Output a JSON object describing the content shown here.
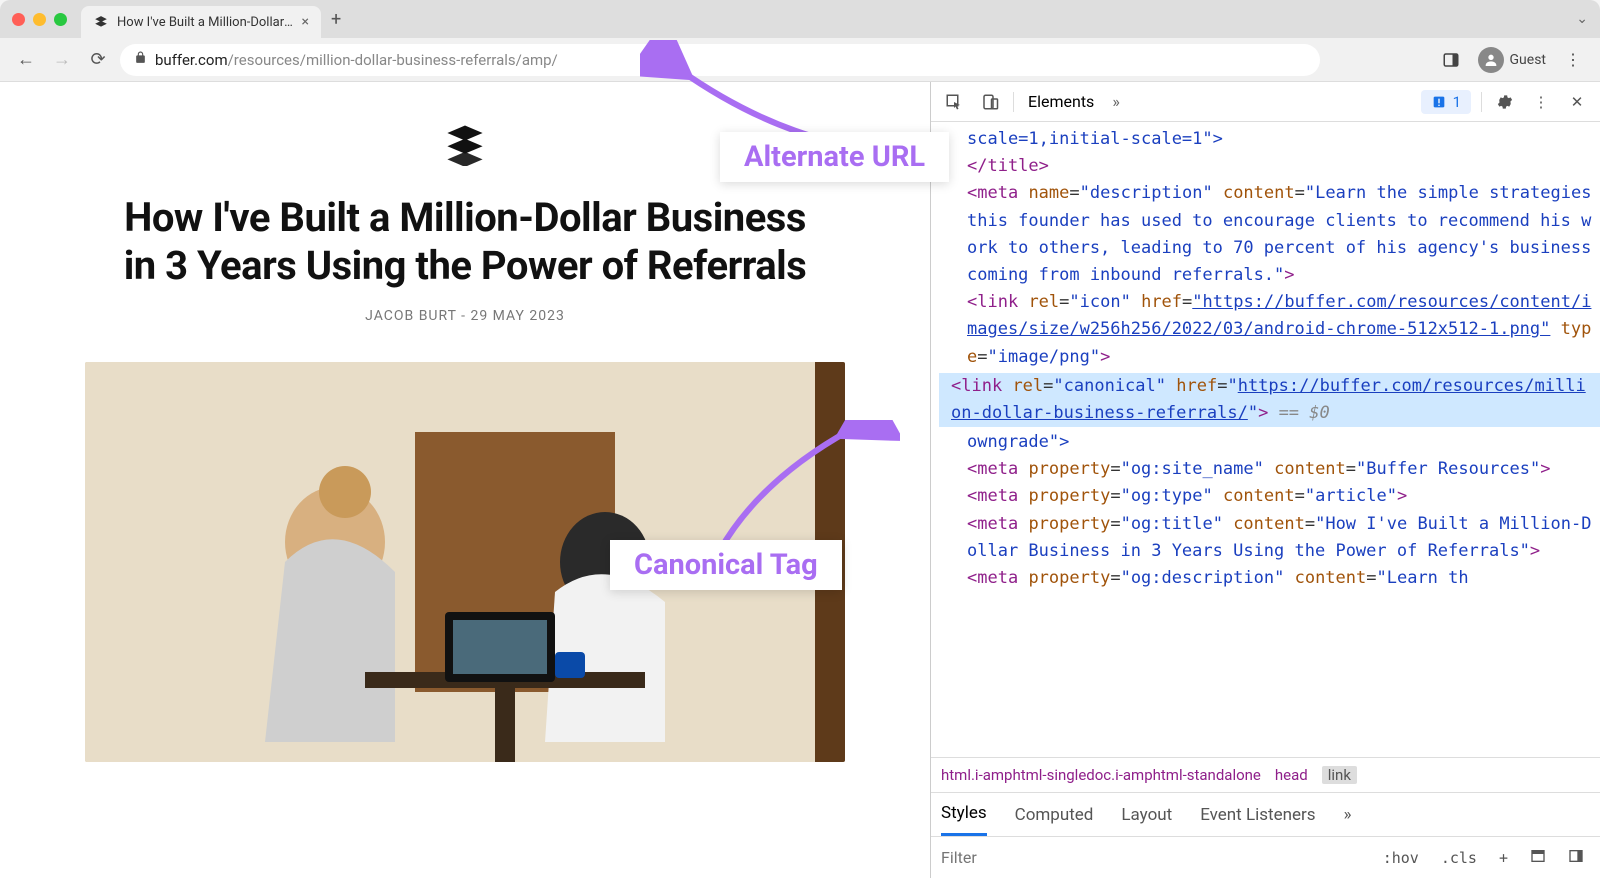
{
  "window": {
    "tab_title": "How I've Built a Million-Dollar B",
    "new_tab_label": "+"
  },
  "toolbar": {
    "url_domain": "buffer.com",
    "url_path": "/resources/million-dollar-business-referrals/amp/",
    "guest_label": "Guest"
  },
  "article": {
    "title": "How I've Built a Million-Dollar Business in 3 Years Using the Power of Referrals",
    "byline": "JACOB BURT - 29 MAY 2023"
  },
  "devtools": {
    "tabs": {
      "elements": "Elements"
    },
    "issues_count": "1",
    "code": {
      "viewport": "scale=1,initial-scale=1\">",
      "title_close": "</title>",
      "meta_desc_open": "<meta name=\"description\" content=\"",
      "meta_desc_text": "Learn the simple strategies this founder has used to encourage clients to recommend his work to others, leading to 70 percent of his agency's business coming from inbound referrals.\">",
      "icon_line": "<link rel=\"icon\" href=\"https://buffer.com/resources/content/images/size/w256h256/2022/03/android-chrome-512x512-1.png\" type=\"image/png\">",
      "canonical_open": "<link rel=\"canonical\" href=\"",
      "canonical_url": "https://buffer.com/resources/million-dollar-business-referrals/",
      "canonical_close": "\"> == $0",
      "downgrade": "owngrade\">",
      "og_sitename": "<meta property=\"og:site_name\" content=\"Buffer Resources\">",
      "og_type": "<meta property=\"og:type\" content=\"article\">",
      "og_title": "<meta property=\"og:title\" content=\"How I've Built a Million-Dollar Business in 3 Years Using the Power of Referrals\">",
      "og_desc": "<meta property=\"og:description\" content=\"Learn th"
    },
    "breadcrumb": {
      "html": "html.i-amphtml-singledoc.i-amphtml-standalone",
      "head": "head",
      "link": "link"
    },
    "styles_tabs": {
      "styles": "Styles",
      "computed": "Computed",
      "layout": "Layout",
      "listeners": "Event Listeners"
    },
    "filter": {
      "placeholder": "Filter",
      "hov": ":hov",
      "cls": ".cls"
    }
  },
  "annotations": {
    "alternate_url": "Alternate URL",
    "canonical_tag": "Canonical Tag"
  }
}
